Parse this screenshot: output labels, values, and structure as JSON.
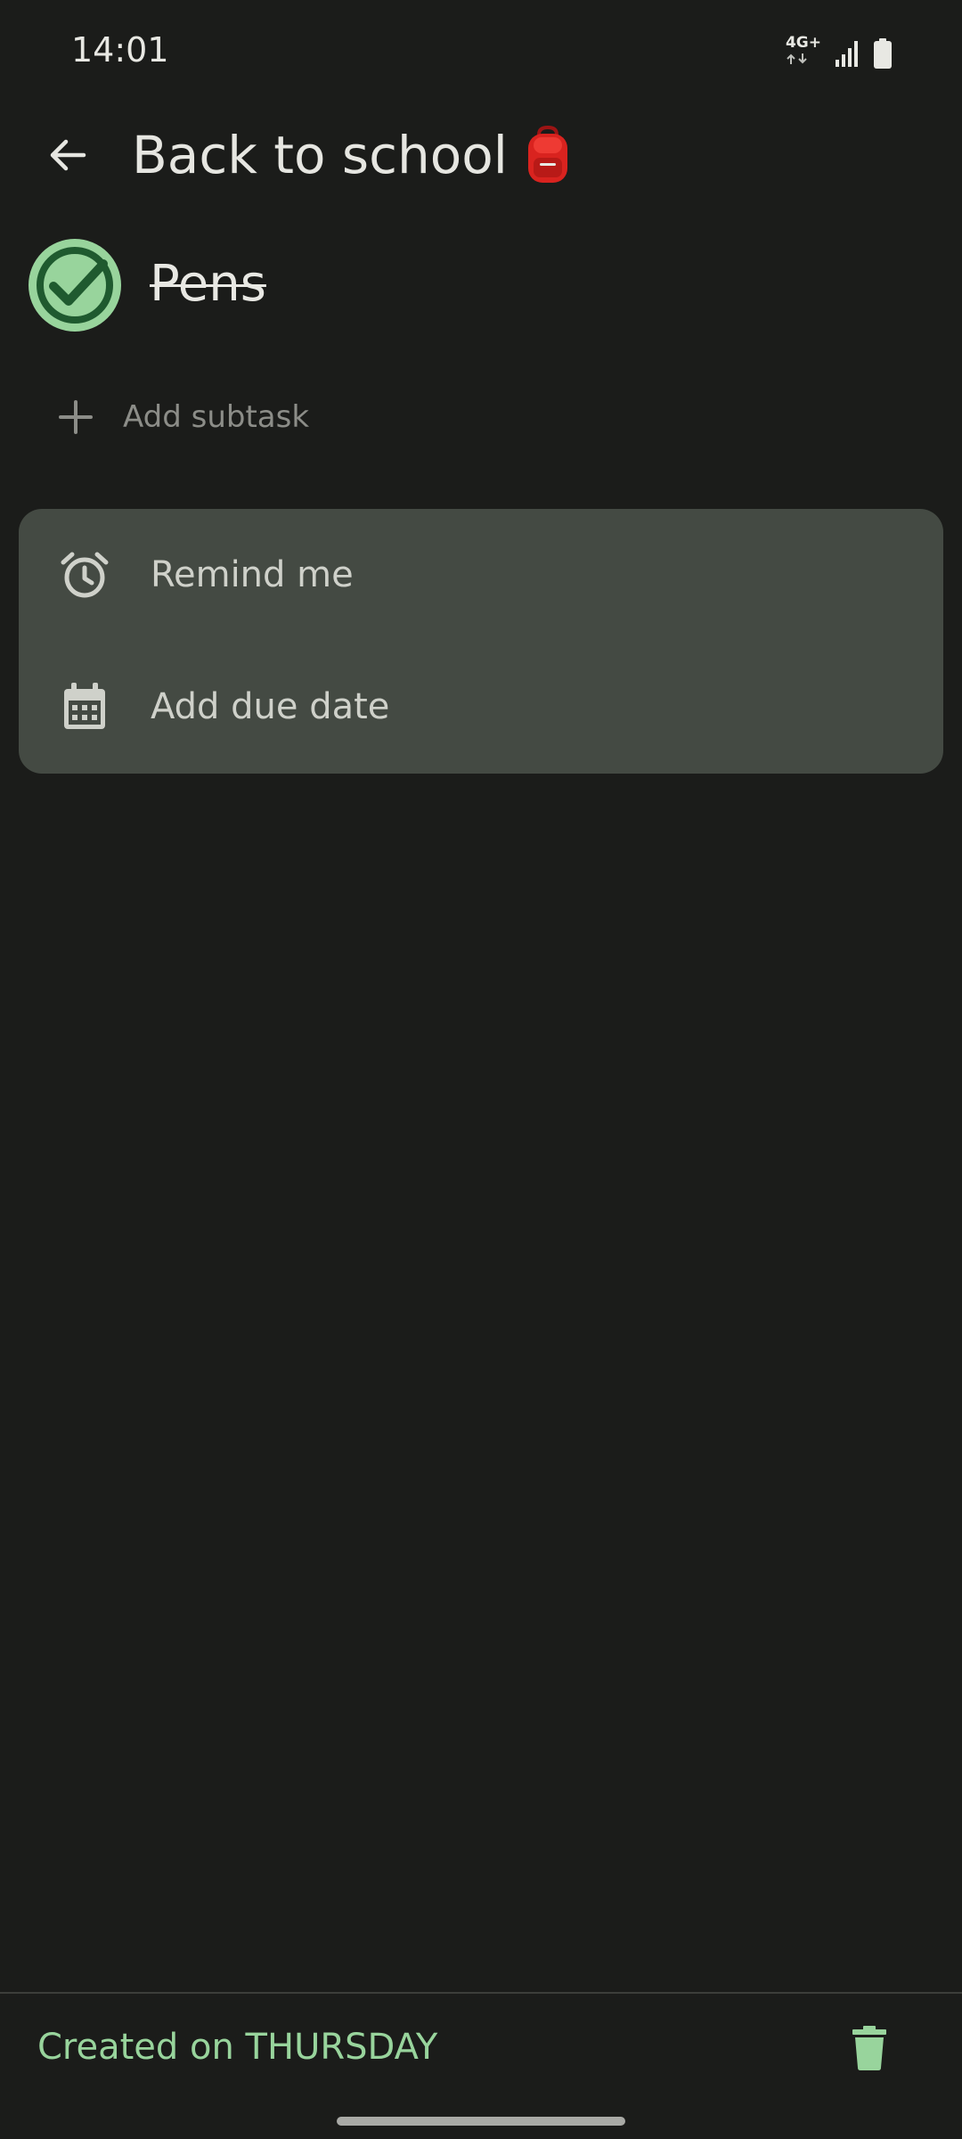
{
  "status_bar": {
    "time": "14:01",
    "network_type": "4G+",
    "icons": [
      "network-activity-icon",
      "signal-icon",
      "battery-icon"
    ]
  },
  "header": {
    "back_icon": "arrow-back-icon",
    "list_title": "Back to school",
    "list_emoji": "🎒"
  },
  "task": {
    "title": "Pens",
    "completed": true,
    "check_icon": "check-circle-icon"
  },
  "add_subtask": {
    "icon": "plus-icon",
    "label": "Add subtask"
  },
  "options": [
    {
      "icon": "alarm-clock-icon",
      "label": "Remind me"
    },
    {
      "icon": "calendar-icon",
      "label": "Add due date"
    }
  ],
  "footer": {
    "created_label": "Created on THURSDAY",
    "delete_icon": "trash-icon"
  },
  "colors": {
    "background": "#1b1c1a",
    "accent_green": "#98d49c",
    "check_dark": "#1f5a2f",
    "card_bg": "#444a43",
    "muted_text": "#8c8d88"
  }
}
